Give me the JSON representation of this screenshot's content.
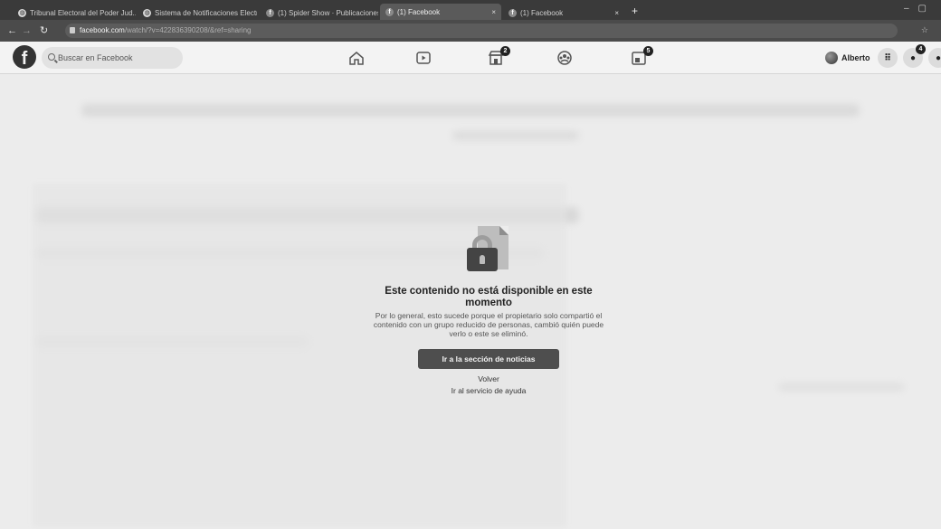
{
  "browser": {
    "tabs": [
      {
        "title": "Tribunal Electoral del Poder Jud...",
        "favicon": "globe"
      },
      {
        "title": "Sistema de Notificaciones Electr...",
        "favicon": "globe"
      },
      {
        "title": "(1) Spider Show · Publicaciones",
        "favicon": "f"
      },
      {
        "title": "(1) Facebook",
        "favicon": "f"
      },
      {
        "title": "(1) Facebook",
        "favicon": "f"
      }
    ],
    "url_host": "facebook.com",
    "url_path": "/watch/?v=422836390208/&ref=sharing"
  },
  "header": {
    "logo": "f",
    "search_placeholder": "Buscar en Facebook",
    "nav_badges": {
      "marketplace": "2",
      "gaming": "5"
    },
    "profile_name": "Alberto",
    "messenger_badge": "4"
  },
  "message": {
    "title": "Este contenido no está disponible en este momento",
    "description": "Por lo general, esto sucede porque el propietario solo compartió el contenido con un grupo reducido de personas, cambió quién puede verlo o este se eliminó.",
    "primary_button": "Ir a la sección de noticias",
    "back_link": "Volver",
    "help_link": "Ir al servicio de ayuda"
  }
}
